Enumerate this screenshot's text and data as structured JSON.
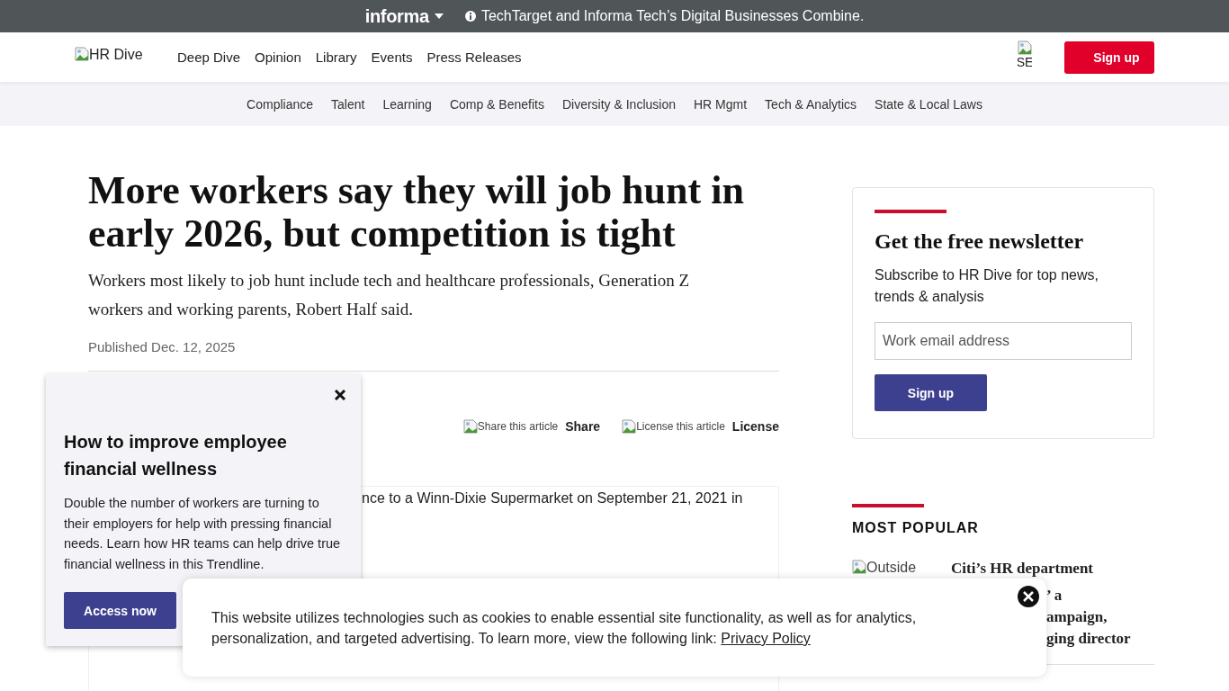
{
  "top_banner": {
    "brand": "informa",
    "message": "TechTarget and Informa Tech’s Digital Businesses Combine."
  },
  "header": {
    "logo_alt": "HR Dive",
    "nav": [
      "Deep Dive",
      "Opinion",
      "Library",
      "Events",
      "Press Releases"
    ],
    "search_alt": "SE",
    "signup": "Sign up"
  },
  "topics": [
    "Compliance",
    "Talent",
    "Learning",
    "Comp & Benefits",
    "Diversity & Inclusion",
    "HR Mgmt",
    "Tech & Analytics",
    "State & Local Laws"
  ],
  "article": {
    "headline": "More workers say they will job hunt in early 2026, but competition is tight",
    "deck": "Workers most likely to job hunt include tech and healthcare professionals, Generation Z workers and working parents, Robert Half said.",
    "published": "Published Dec. 12, 2025",
    "actions": [
      {
        "alt": "Share this article",
        "label": "Share"
      },
      {
        "alt": "License this article",
        "label": "License"
      }
    ],
    "image_caption": "nce to a Winn-Dixie Supermarket on September 21, 2021 in"
  },
  "newsletter": {
    "title": "Get the free newsletter",
    "text": "Subscribe to HR Dive for top news, trends & analysis",
    "email": {
      "placeholder": "Work email address"
    },
    "button": "Sign up"
  },
  "most_popular": {
    "title": "MOST POPULAR",
    "items": [
      {
        "image_alt": "Outside",
        "title_lines": [
          "Citi’s HR department",
          "’ a",
          "ampaign,",
          "ging director"
        ]
      }
    ]
  },
  "promo_popup": {
    "title": "How to improve employee financial wellness",
    "text": "Double the number of workers are turning to their employers for help with pressing financial needs. Learn how HR teams can help drive true financial wellness in this Trendline.",
    "button": "Access now"
  },
  "cookie_banner": {
    "text": "This website utilizes technologies such as cookies to enable essential site functionality, as well as for analytics, personalization, and targeted advertising. To learn more, view the following link: ",
    "link": "Privacy Policy"
  }
}
